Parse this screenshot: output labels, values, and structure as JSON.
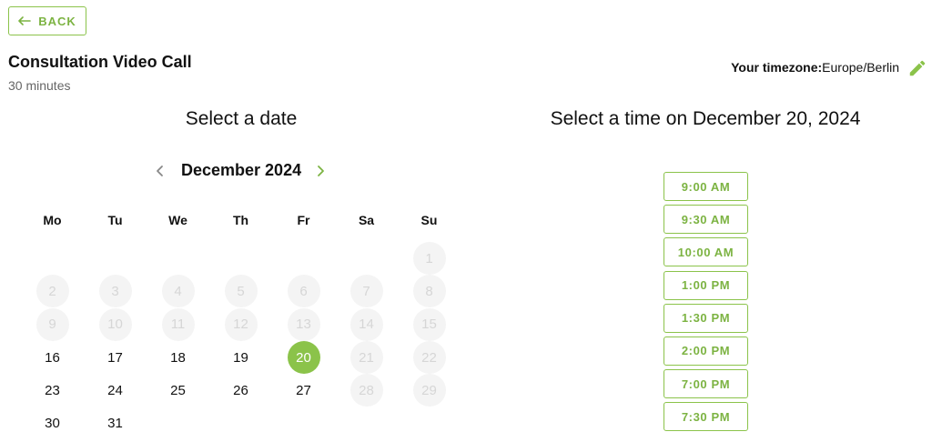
{
  "back_button": {
    "label": "BACK",
    "icon": "arrow-left-icon"
  },
  "event": {
    "title": "Consultation Video Call",
    "duration": "30 minutes"
  },
  "timezone": {
    "label": "Your timezone:",
    "value": "Europe/Berlin",
    "edit_icon": "pencil-icon"
  },
  "date_section": {
    "title": "Select a date"
  },
  "time_section": {
    "title": "Select a time on December 20, 2024"
  },
  "calendar": {
    "month_label": "December 2024",
    "prev_icon": "chevron-left-icon",
    "next_icon": "chevron-right-icon",
    "weekdays": [
      "Mo",
      "Tu",
      "We",
      "Th",
      "Fr",
      "Sa",
      "Su"
    ],
    "weeks": [
      [
        null,
        null,
        null,
        null,
        null,
        null,
        {
          "d": "1",
          "s": "disabled"
        }
      ],
      [
        {
          "d": "2",
          "s": "disabled"
        },
        {
          "d": "3",
          "s": "disabled"
        },
        {
          "d": "4",
          "s": "disabled"
        },
        {
          "d": "5",
          "s": "disabled"
        },
        {
          "d": "6",
          "s": "disabled"
        },
        {
          "d": "7",
          "s": "disabled"
        },
        {
          "d": "8",
          "s": "disabled"
        }
      ],
      [
        {
          "d": "9",
          "s": "disabled"
        },
        {
          "d": "10",
          "s": "disabled"
        },
        {
          "d": "11",
          "s": "disabled"
        },
        {
          "d": "12",
          "s": "disabled"
        },
        {
          "d": "13",
          "s": "disabled"
        },
        {
          "d": "14",
          "s": "disabled"
        },
        {
          "d": "15",
          "s": "disabled"
        }
      ],
      [
        {
          "d": "16",
          "s": "avail"
        },
        {
          "d": "17",
          "s": "avail"
        },
        {
          "d": "18",
          "s": "avail"
        },
        {
          "d": "19",
          "s": "avail"
        },
        {
          "d": "20",
          "s": "selected"
        },
        {
          "d": "21",
          "s": "disabled"
        },
        {
          "d": "22",
          "s": "disabled"
        }
      ],
      [
        {
          "d": "23",
          "s": "avail"
        },
        {
          "d": "24",
          "s": "avail"
        },
        {
          "d": "25",
          "s": "avail"
        },
        {
          "d": "26",
          "s": "avail"
        },
        {
          "d": "27",
          "s": "avail"
        },
        {
          "d": "28",
          "s": "disabled"
        },
        {
          "d": "29",
          "s": "disabled"
        }
      ],
      [
        {
          "d": "30",
          "s": "avail"
        },
        {
          "d": "31",
          "s": "avail"
        },
        null,
        null,
        null,
        null,
        null
      ]
    ]
  },
  "time_slots": [
    "9:00 AM",
    "9:30 AM",
    "10:00 AM",
    "1:00 PM",
    "1:30 PM",
    "2:00 PM",
    "7:00 PM",
    "7:30 PM"
  ],
  "colors": {
    "accent": "#8bc34a",
    "accent_text": "#7cb342",
    "disabled_bg": "#f4f4f4",
    "disabled_text": "#d6d6d6"
  }
}
